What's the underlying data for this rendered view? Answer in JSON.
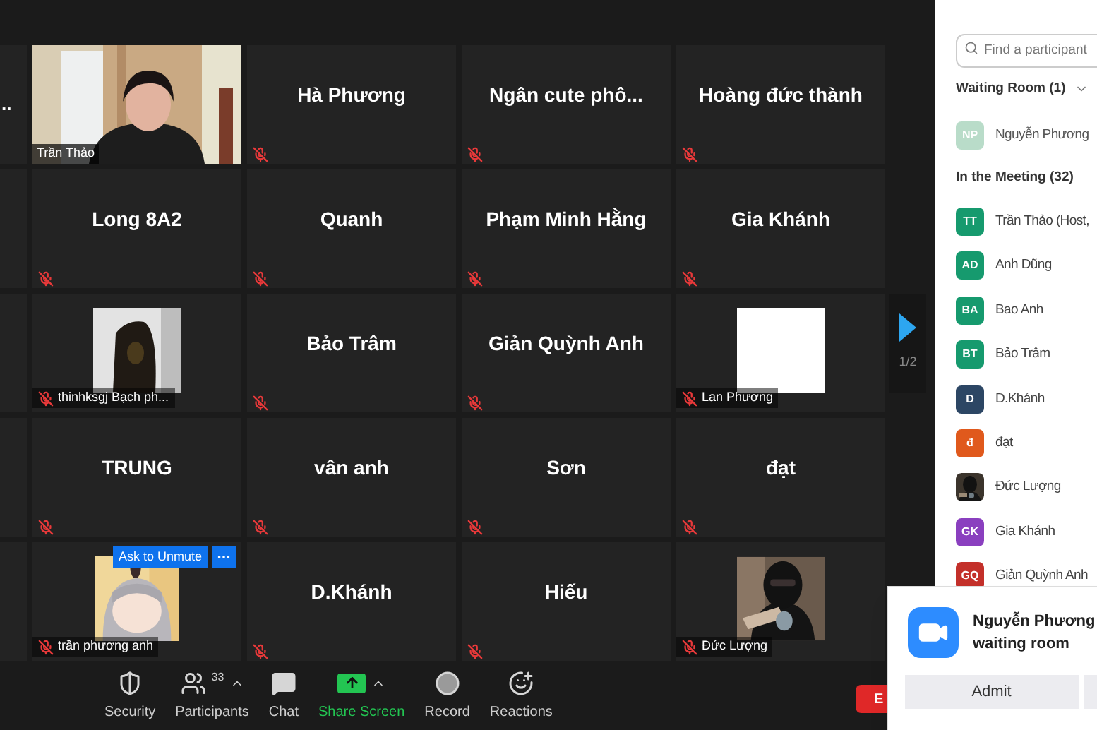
{
  "left_column": {
    "label": ".."
  },
  "tiles": [
    {
      "kind": "video-full",
      "name": "Trần Thảo",
      "muted": false
    },
    {
      "kind": "name",
      "name": "Hà Phương",
      "muted": true
    },
    {
      "kind": "name",
      "name": "Ngân cute phô...",
      "muted": true
    },
    {
      "kind": "name",
      "name": "Hoàng đức thành",
      "muted": true
    },
    {
      "kind": "name",
      "name": "Long 8A2",
      "muted": true
    },
    {
      "kind": "name",
      "name": "Quanh",
      "muted": true
    },
    {
      "kind": "name",
      "name": "Phạm Minh Hằng",
      "muted": true
    },
    {
      "kind": "name",
      "name": "Gia Khánh",
      "muted": true
    },
    {
      "kind": "video",
      "name": "thinhksgj Bạch ph...",
      "muted": true
    },
    {
      "kind": "name",
      "name": "Bảo Trâm",
      "muted": true
    },
    {
      "kind": "name",
      "name": "Giản Quỳnh Anh",
      "muted": true
    },
    {
      "kind": "blank-video",
      "name": "Lan Phương",
      "muted": true
    },
    {
      "kind": "name",
      "name": "TRUNG",
      "muted": true
    },
    {
      "kind": "name",
      "name": "vân anh",
      "muted": true
    },
    {
      "kind": "name",
      "name": "Sơn",
      "muted": true
    },
    {
      "kind": "name",
      "name": "đạt",
      "muted": true
    },
    {
      "kind": "video",
      "name": "trần phương anh",
      "muted": true,
      "overlay": {
        "button": "Ask to Unmute"
      }
    },
    {
      "kind": "name",
      "name": "D.Khánh",
      "muted": true
    },
    {
      "kind": "name",
      "name": "Hiếu",
      "muted": true
    },
    {
      "kind": "video",
      "name": "Đức Lượng",
      "muted": true
    }
  ],
  "page": "1/2",
  "panel": {
    "search": {
      "placeholder": "Find a participant"
    },
    "waiting_room": {
      "title": "Waiting Room (1)",
      "expanded": true,
      "items": [
        {
          "kind": "initials",
          "initials": "NP",
          "name": "Nguyễn Phương",
          "color": "#b9dcc9"
        }
      ]
    },
    "meeting": {
      "title": "In the Meeting (32)",
      "items": [
        {
          "kind": "initials",
          "initials": "TT",
          "name": "Trần Thảo (Host,",
          "color": "#169a6e"
        },
        {
          "kind": "initials",
          "initials": "AD",
          "name": "Anh Dũng",
          "color": "#169a6e"
        },
        {
          "kind": "initials",
          "initials": "BA",
          "name": "Bao Anh",
          "color": "#169a6e"
        },
        {
          "kind": "initials",
          "initials": "BT",
          "name": "Bảo Trâm",
          "color": "#169a6e"
        },
        {
          "kind": "initials",
          "initials": "D",
          "name": "D.Khánh",
          "color": "#2c4664"
        },
        {
          "kind": "initials",
          "initials": "đ",
          "name": "đạt",
          "color": "#e0591c"
        },
        {
          "kind": "picture",
          "name": "Đức Lượng"
        },
        {
          "kind": "initials",
          "initials": "GK",
          "name": "Gia Khánh",
          "color": "#8a3fbf"
        },
        {
          "kind": "initials",
          "initials": "GQ",
          "name": "Giản Quỳnh Anh",
          "color": "#c3302a"
        }
      ]
    }
  },
  "toolbar": [
    {
      "kind": "security",
      "label": "Security"
    },
    {
      "kind": "participants",
      "label": "Participants",
      "badge": "33",
      "caret": true
    },
    {
      "kind": "chat",
      "label": "Chat"
    },
    {
      "kind": "share",
      "label": "Share Screen",
      "caret": true
    },
    {
      "kind": "record",
      "label": "Record"
    },
    {
      "kind": "reactions",
      "label": "Reactions"
    }
  ],
  "end_button": "E",
  "notification": {
    "title": "Nguyễn Phương",
    "subtitle": "waiting room",
    "buttons": [
      "Admit"
    ]
  }
}
